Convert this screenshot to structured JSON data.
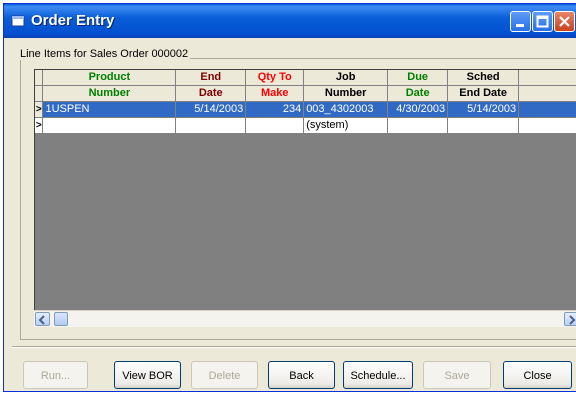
{
  "window": {
    "title": "Order Entry"
  },
  "group": {
    "label": "Line Items for Sales Order 000002"
  },
  "grid": {
    "columns": [
      {
        "line1": "Product",
        "line2": "Number",
        "color": "#008000"
      },
      {
        "line1": "End",
        "line2": "Date",
        "color": "#800000"
      },
      {
        "line1": "Qty To",
        "line2": "Make",
        "color": "#ff0000"
      },
      {
        "line1": "Job",
        "line2": "Number",
        "color": "#000000"
      },
      {
        "line1": "Due",
        "line2": "Date",
        "color": "#008000"
      },
      {
        "line1": "Sched",
        "line2": "End Date",
        "color": "#000000"
      },
      {
        "line1": "",
        "line2": "",
        "color": "#000000"
      }
    ],
    "rows": [
      {
        "marker": ">",
        "cells": [
          "1USPEN",
          "5/14/2003",
          "234",
          "003_4302003",
          "4/30/2003",
          "5/14/2003",
          ""
        ]
      },
      {
        "marker": ">",
        "cells": [
          "",
          "",
          "",
          "(system)",
          "",
          "",
          ""
        ]
      }
    ]
  },
  "buttons": {
    "run": "Run...",
    "view_bor": "View BOR",
    "delete": "Delete",
    "back": "Back",
    "schedule": "Schedule...",
    "save": "Save",
    "close": "Close"
  }
}
